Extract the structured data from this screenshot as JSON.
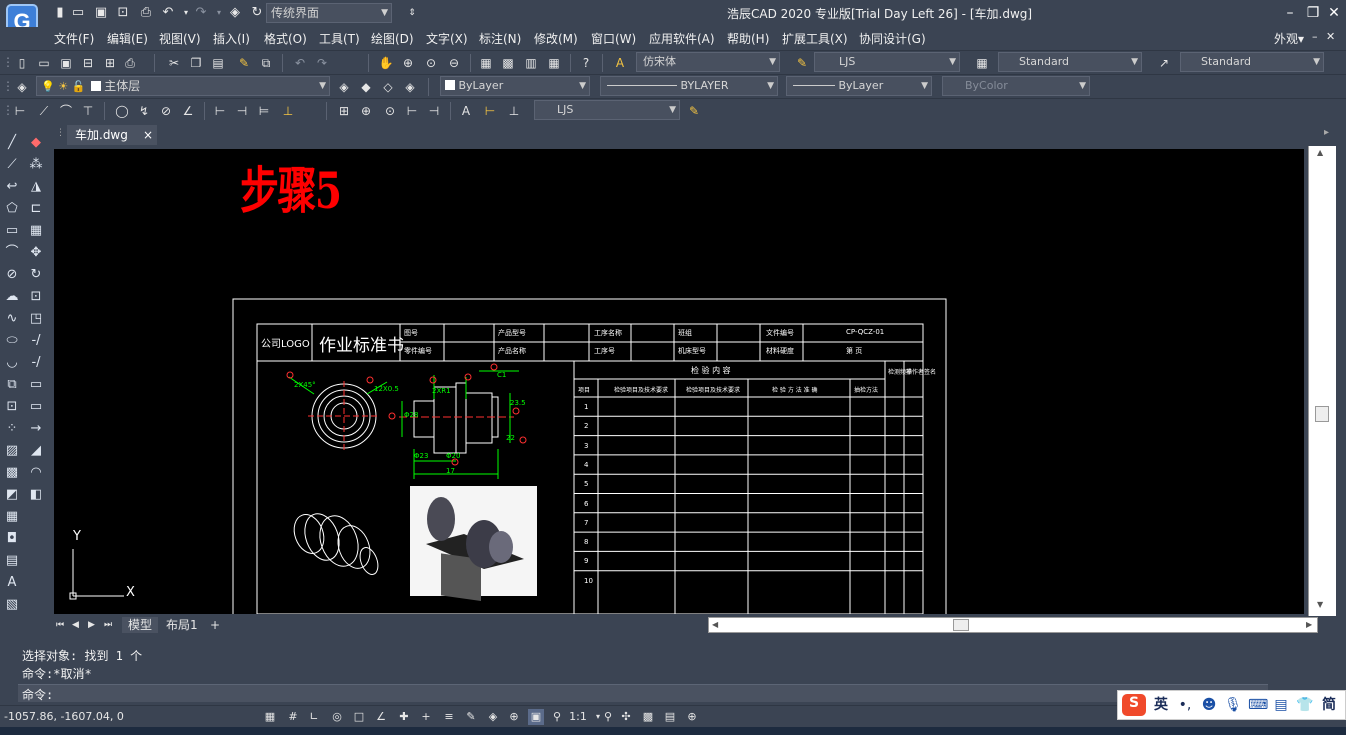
{
  "title_bar": {
    "logo_letter": "G",
    "workspace_selected": "传统界面",
    "app_title": "浩辰CAD 2020 专业版[Trial Day Left 26] - [车加.dwg]"
  },
  "menu": {
    "items": [
      "文件(F)",
      "编辑(E)",
      "视图(V)",
      "插入(I)",
      "格式(O)",
      "工具(T)",
      "绘图(D)",
      "文字(X)",
      "标注(N)",
      "修改(M)",
      "窗口(W)",
      "应用软件(A)",
      "帮助(H)",
      "扩展工具(X)",
      "协同设计(G)"
    ],
    "appearance": "外观▾"
  },
  "toolbar1": {
    "text_style": "仿宋体",
    "dim_style": "LJS",
    "table_style": "Standard",
    "multileader_style": "Standard"
  },
  "toolbar2": {
    "layer": "主体层",
    "color": "ByLayer",
    "linetype": "BYLAYER",
    "lineweight": "ByLayer",
    "plotstyle": "ByColor"
  },
  "toolbar3": {
    "dim_style": "LJS"
  },
  "document": {
    "tab_name": "车加.dwg",
    "close_glyph": "×"
  },
  "drawing": {
    "red_heading": "步骤5",
    "form": {
      "logo_cell": "公司LOGO",
      "title_cell": "作业标准书",
      "header_row1": [
        "图号",
        "",
        "产品型号",
        "",
        "工序名称",
        "",
        "班组",
        "",
        "文件编号",
        "CP-QCZ-01"
      ],
      "header_row2": [
        "零件编号",
        "",
        "产品名称",
        "",
        "工序号",
        "",
        "机床型号",
        "",
        "材料硬度",
        "第 页"
      ],
      "check_header": "检 验 内 容",
      "check_cols": [
        "项目",
        "检验项目及技术要求",
        "检验项目及技术要求",
        "检 验 方 法 准 确",
        "抽检方法",
        "检测频率",
        "操作者签名"
      ],
      "rows": [
        "1",
        "2",
        "3",
        "4",
        "5",
        "6",
        "7",
        "8",
        "9",
        "10"
      ]
    },
    "dims": [
      "2X45°",
      "12X0.5",
      "2XR1",
      "Φ28",
      "C1",
      "22",
      "Φ23",
      "Φ20",
      "17",
      "23.5"
    ],
    "ucs_y": "Y",
    "ucs_x": "X"
  },
  "model_tabs": [
    "模型",
    "布局1",
    "+"
  ],
  "command": {
    "history": [
      "选择对象: 找到 1 个",
      "命令:*取消*"
    ],
    "prompt": "命令:"
  },
  "status": {
    "coords": "-1057.86, -1607.04, 0",
    "annotation_scale": "1:1"
  },
  "ime": {
    "logo": "S",
    "mode": "英",
    "punct": "•,",
    "script": "简"
  },
  "colors": {
    "chrome": "#3b4453",
    "canvas": "#000000",
    "heading": "#ff0000",
    "dimension": "#00ff00"
  }
}
